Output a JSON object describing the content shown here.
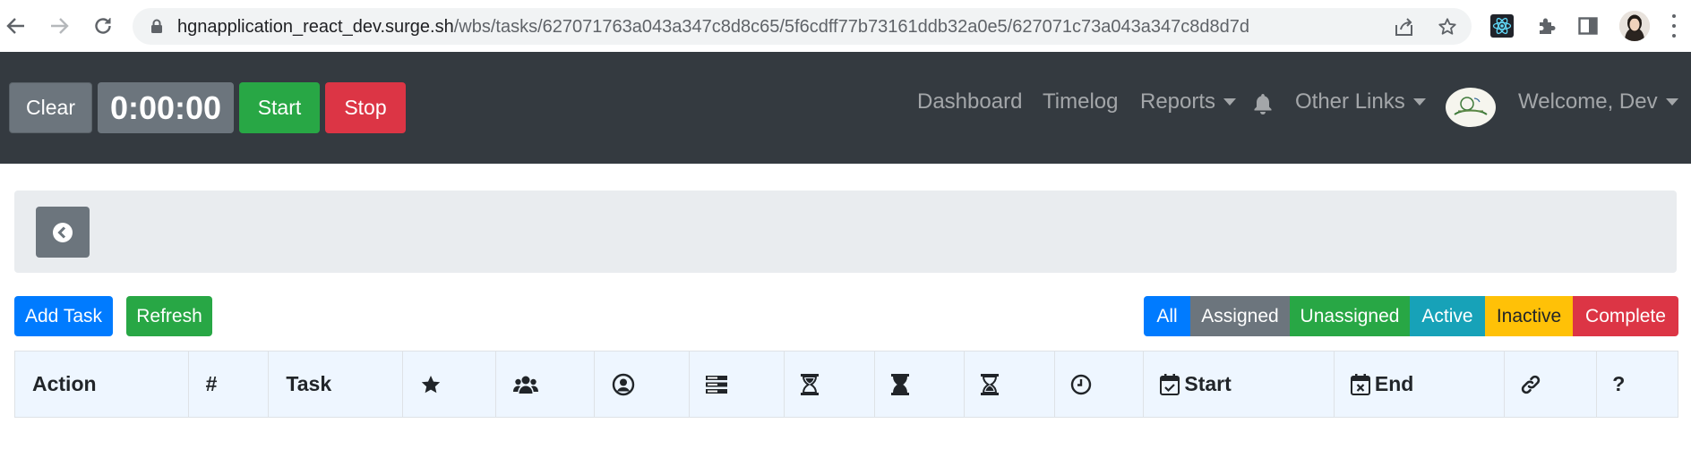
{
  "browser": {
    "url_host": "hgnapplication_react_dev.surge.sh",
    "url_path": "/wbs/tasks/627071763a043a347c8d8c65/5f6cdff77b73161ddb32a0e5/627071c73a043a347c8d8d7d",
    "icons": [
      "back-arrow-icon",
      "forward-arrow-icon",
      "reload-icon",
      "lock-icon",
      "share-icon",
      "bookmark-star-icon",
      "react-devtools-icon",
      "extensions-puzzle-icon",
      "side-panel-icon",
      "profile-avatar",
      "kebab-menu-icon"
    ]
  },
  "navbar": {
    "clear_label": "Clear",
    "timer": "0:00:00",
    "start_label": "Start",
    "stop_label": "Stop",
    "links": {
      "dashboard": "Dashboard",
      "timelog": "Timelog",
      "reports": "Reports",
      "other_links": "Other Links",
      "welcome": "Welcome, Dev"
    }
  },
  "actions": {
    "add_task": "Add Task",
    "refresh": "Refresh"
  },
  "filters": [
    {
      "label": "All",
      "color": "#007bff"
    },
    {
      "label": "Assigned",
      "color": "#6c757d"
    },
    {
      "label": "Unassigned",
      "color": "#28a745"
    },
    {
      "label": "Active",
      "color": "#17a2b8"
    },
    {
      "label": "Inactive",
      "color": "#ffc107"
    },
    {
      "label": "Complete",
      "color": "#dc3545"
    }
  ],
  "table": {
    "headers": {
      "action": "Action",
      "number": "#",
      "task": "Task",
      "start": "Start",
      "end": "End",
      "help": "?"
    },
    "header_icons": [
      "star-icon",
      "users-icon",
      "user-circle-icon",
      "server-stack-icon",
      "hourglass-start-icon",
      "hourglass-half-icon",
      "hourglass-end-icon",
      "clock-icon",
      "calendar-check-icon",
      "calendar-times-icon",
      "link-icon"
    ]
  },
  "colors": {
    "navbar_bg": "#343a40",
    "breadcrumb_bg": "#e9ecef",
    "table_header_bg": "#eef6ff"
  }
}
